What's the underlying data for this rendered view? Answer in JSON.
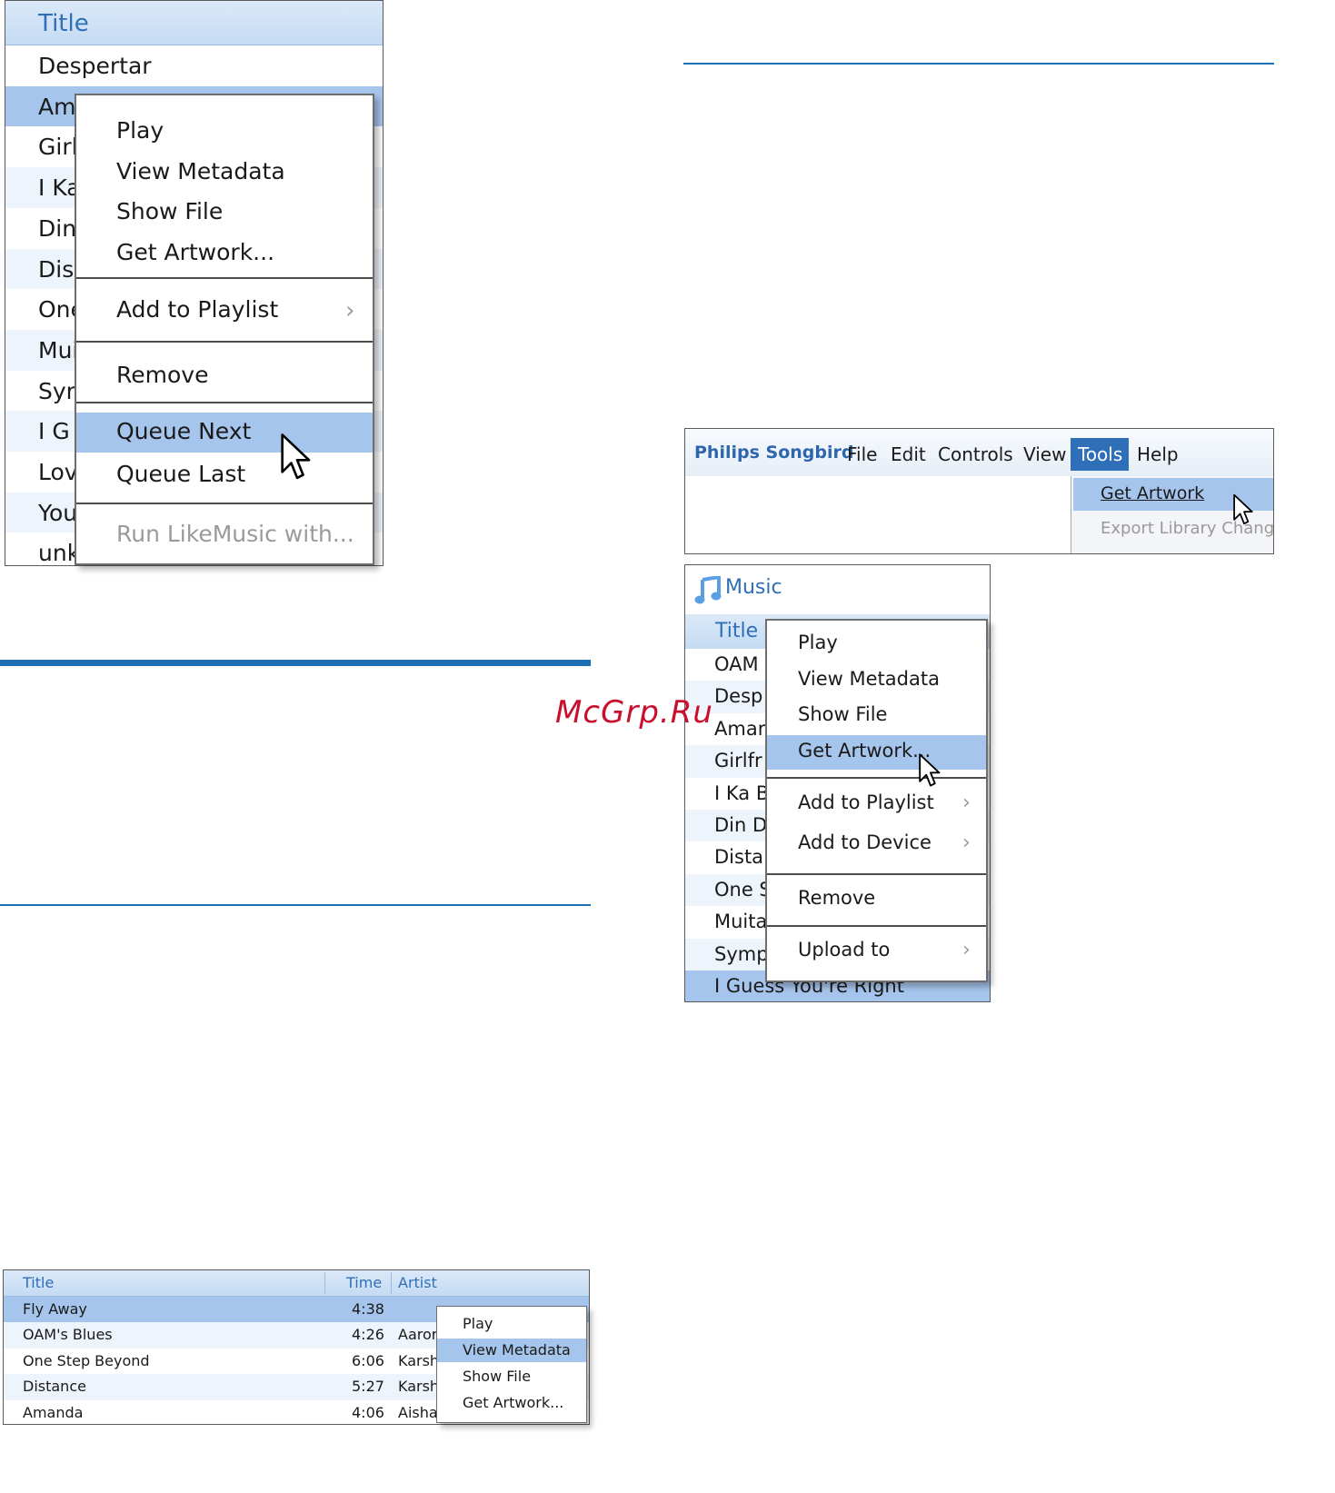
{
  "watermark": "McGrp.Ru",
  "colors": {
    "accent_blue": "#1f6fb4",
    "selection": "#a6c5ec",
    "header": "#cfe2f7",
    "stripe": "#eef4fb"
  },
  "panel_a": {
    "column_title": "Title",
    "rows": [
      "Despertar",
      "Am",
      "Girl",
      "I Ka",
      "Din",
      "Dist",
      "One",
      "Mui",
      "Syr",
      "I G",
      "Lov",
      "You",
      "unk"
    ],
    "menu": {
      "play": "Play",
      "view_metadata": "View Metadata",
      "show_file": "Show File",
      "get_artwork": "Get Artwork...",
      "add_to_playlist": "Add to Playlist",
      "remove": "Remove",
      "queue_next": "Queue Next",
      "queue_last": "Queue Last",
      "run_likemusic": "Run LikeMusic with..."
    }
  },
  "panel_b": {
    "app_name": "Philips Songbird",
    "menubar": [
      "File",
      "Edit",
      "Controls",
      "View",
      "Tools",
      "Help"
    ],
    "tools_menu": {
      "get_artwork": "Get Artwork",
      "export": "Export Library Chang"
    }
  },
  "panel_c": {
    "section": "Music",
    "icon": "music-note-icon",
    "column_title": "Title",
    "rows": [
      "OAM",
      "Desp",
      "Amar",
      "Girlfr",
      "I Ka B",
      "Din D",
      "Dista",
      "One S",
      "Muita",
      "Symp",
      "I Guess You're Right"
    ],
    "menu": {
      "play": "Play",
      "view_metadata": "View Metadata",
      "show_file": "Show File",
      "get_artwork": "Get Artwork...",
      "add_to_playlist": "Add to Playlist",
      "add_to_device": "Add to Device",
      "remove": "Remove",
      "upload_to": "Upload to"
    }
  },
  "panel_d": {
    "columns": {
      "title": "Title",
      "time": "Time",
      "artist": "Artist"
    },
    "rows": [
      {
        "title": "Fly Away",
        "time": "4:38",
        "artist": ""
      },
      {
        "title": "OAM's Blues",
        "time": "4:26",
        "artist": "Aaror"
      },
      {
        "title": "One Step Beyond",
        "time": "6:06",
        "artist": "Karsh"
      },
      {
        "title": "Distance",
        "time": "5:27",
        "artist": "Karsh"
      },
      {
        "title": "Amanda",
        "time": "4:06",
        "artist": "Aisha"
      }
    ],
    "menu": {
      "play": "Play",
      "view_metadata": "View Metadata",
      "show_file": "Show File",
      "get_artwork": "Get Artwork..."
    }
  }
}
